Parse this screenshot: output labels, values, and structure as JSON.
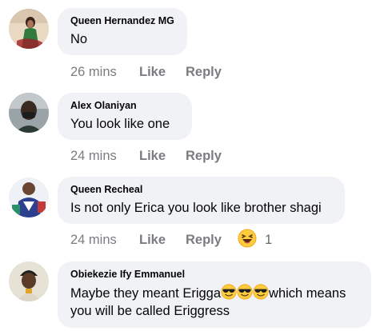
{
  "comments": [
    {
      "author": "Queen Hernandez MG",
      "text": "No",
      "time": "26 mins",
      "like_label": "Like",
      "reply_label": "Reply",
      "avatar_icon": "user-avatar-photo"
    },
    {
      "author": "Alex Olaniyan",
      "text": "You look like one",
      "time": "24 mins",
      "like_label": "Like",
      "reply_label": "Reply",
      "avatar_icon": "user-avatar-photo"
    },
    {
      "author": "Queen Recheal",
      "text": "Is not only Erica you look like brother shagi",
      "time": "24 mins",
      "like_label": "Like",
      "reply_label": "Reply",
      "avatar_icon": "user-avatar-photo",
      "reaction": {
        "icon": "laughing-face-icon",
        "count": "1"
      }
    },
    {
      "author": "Obiekezie Ify Emmanuel",
      "text_before": "Maybe they meant Erigga",
      "emoji": "smiling-face-with-sunglasses-icon",
      "emoji_count": 3,
      "text_after": "which means you will be called Eriggress",
      "avatar_icon": "user-avatar-photo"
    }
  ],
  "colors": {
    "bubble": "#f0f2f5",
    "meta_text": "#7a7c80",
    "emoji_yellow": "#ffcc3e"
  }
}
